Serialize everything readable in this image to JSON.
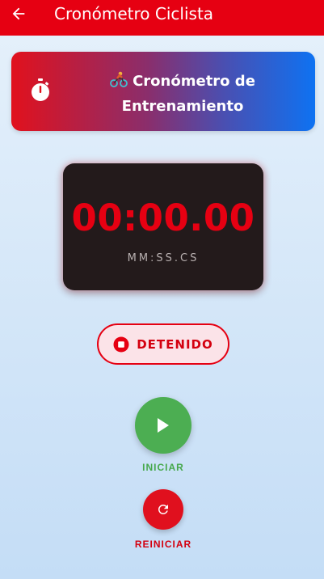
{
  "appbar": {
    "title": "Cronómetro Ciclista",
    "back_icon": "arrow-left-icon",
    "color": "#e60012"
  },
  "header": {
    "emoji": "🚴",
    "title_line1": "Cronómetro de",
    "title_line2": "Entrenamiento",
    "icon": "stopwatch-icon"
  },
  "timer": {
    "display": "00:00.00",
    "format": "MM:SS.CS",
    "color": "#e60012"
  },
  "status": {
    "label": "DETENIDO",
    "icon": "stop-circle-icon",
    "color": "#e60012"
  },
  "controls": {
    "start_label": "INICIAR",
    "start_icon": "play-icon",
    "start_color": "#4cae52",
    "reset_label": "REINICIAR",
    "reset_icon": "refresh-icon",
    "reset_color": "#e0101e"
  }
}
